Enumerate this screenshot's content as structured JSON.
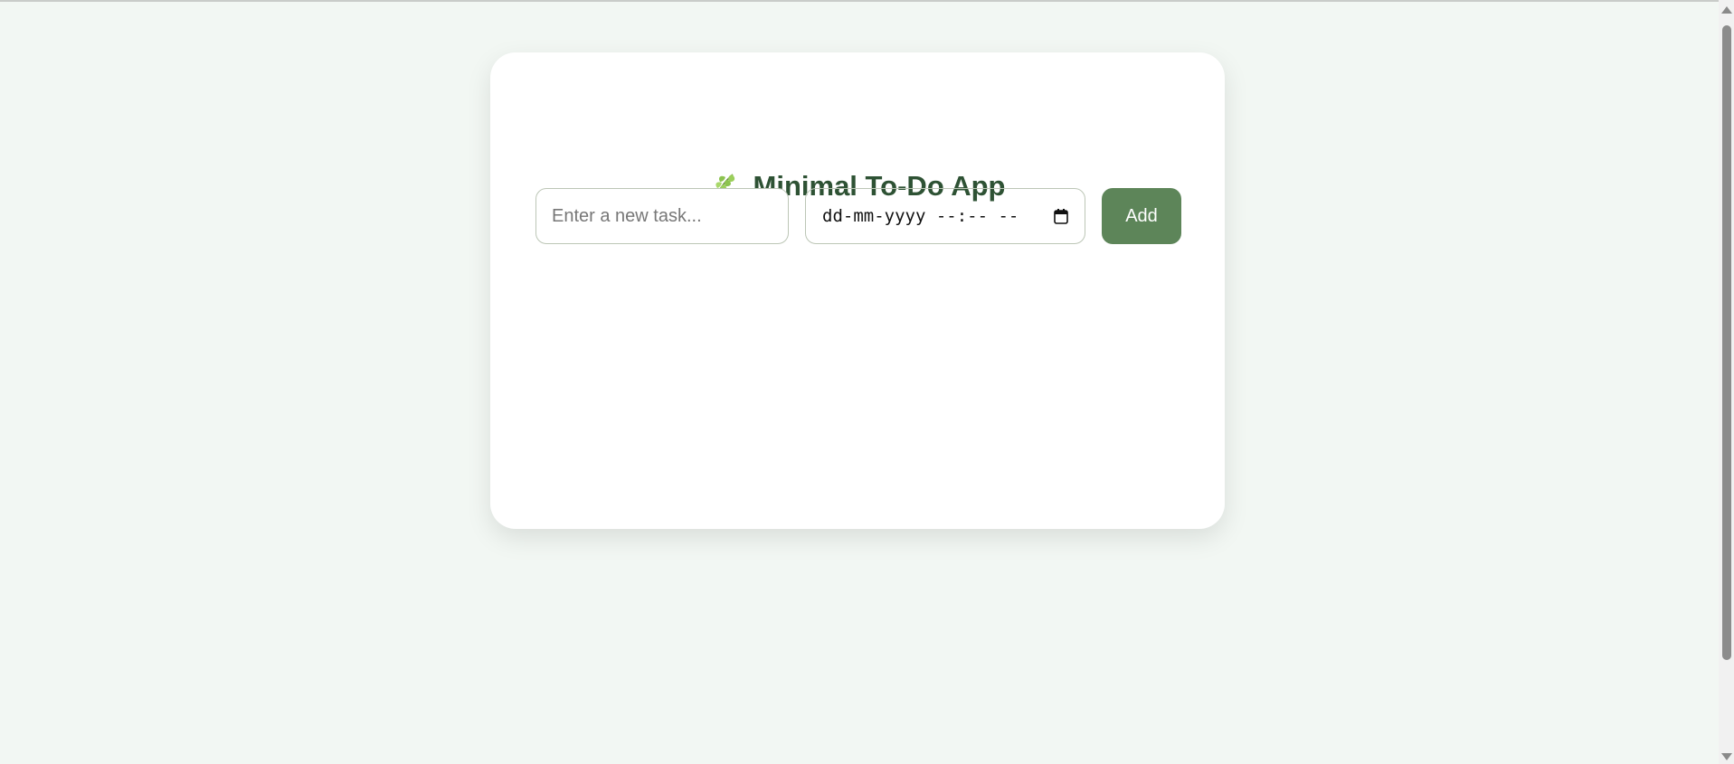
{
  "app": {
    "title": "Minimal To-Do App",
    "title_icon": "leaf-icon"
  },
  "form": {
    "task_placeholder": "Enter a new task...",
    "task_value": "",
    "datetime_placeholder": "dd-mm-yyyy --:-- --",
    "calendar_icon": "calendar-icon",
    "add_label": "Add"
  },
  "tasks": [],
  "colors": {
    "background": "#f2f7f3",
    "card": "#ffffff",
    "title": "#2e5234",
    "accent_button": "#5d8559",
    "input_border": "#bcc6b6"
  }
}
